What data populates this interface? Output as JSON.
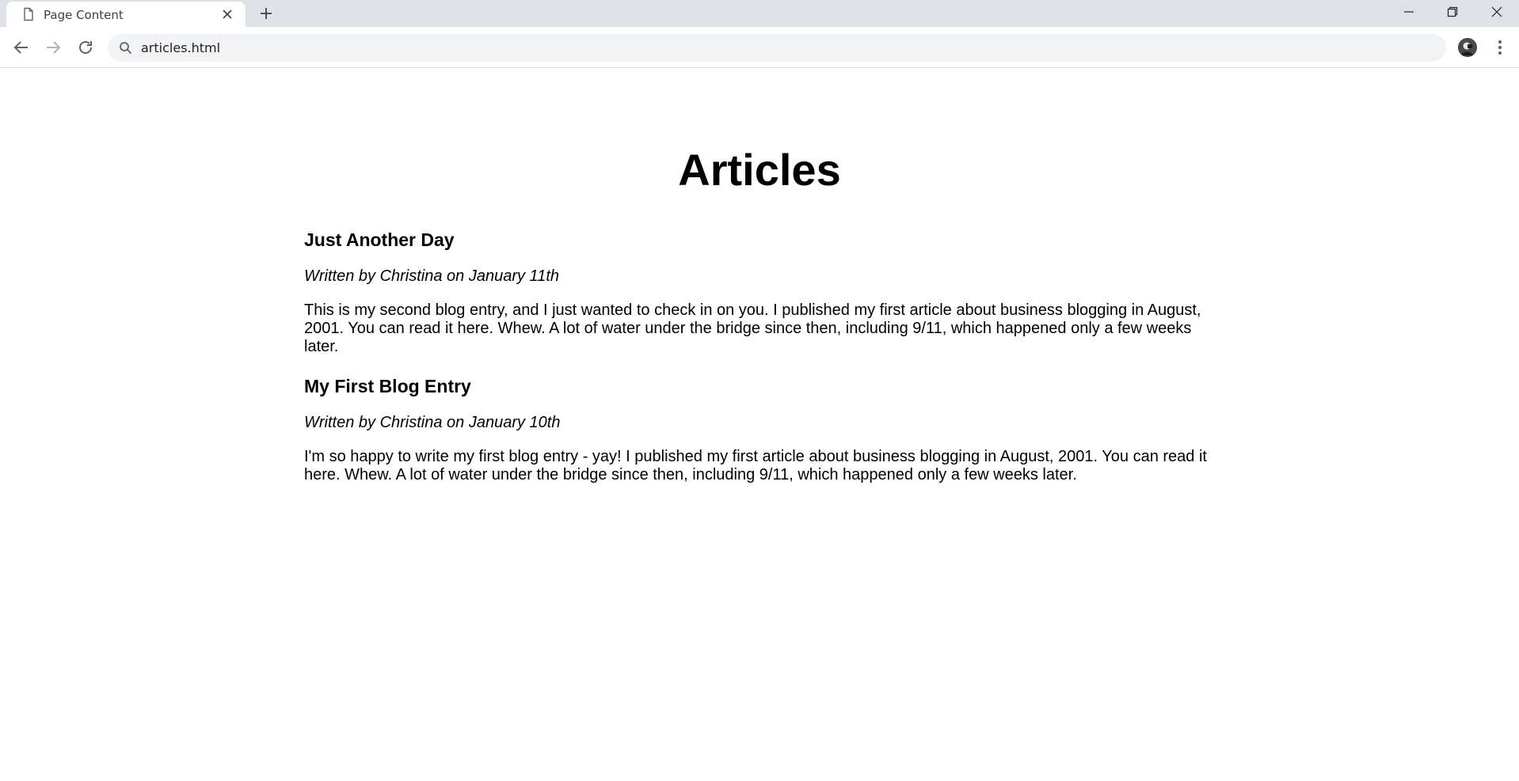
{
  "browser": {
    "tab": {
      "title": "Page Content"
    },
    "address": {
      "value": "articles.html"
    }
  },
  "icons": {
    "tab_favicon": "document-icon",
    "tab_close": "close-icon",
    "new_tab": "plus-icon",
    "back": "arrow-left-icon",
    "forward": "arrow-right-icon",
    "reload": "reload-icon",
    "search": "search-icon",
    "profile": "avatar",
    "menu": "kebab-menu-icon",
    "minimize": "minimize-icon",
    "maximize": "restore-icon",
    "close_window": "close-icon"
  },
  "page": {
    "title": "Articles",
    "articles": [
      {
        "title": "Just Another Day",
        "byline": "Written by Christina on January 11th",
        "body": "This is my second blog entry, and I just wanted to check in on you. I published my first article about business blogging in August, 2001. You can read it here. Whew. A lot of water under the bridge since then, including 9/11, which happened only a few weeks later."
      },
      {
        "title": "My First Blog Entry",
        "byline": "Written by Christina on January 10th",
        "body": "I'm so happy to write my first blog entry - yay! I published my first article about business blogging in August, 2001. You can read it here. Whew. A lot of water under the bridge since then, including 9/11, which happened only a few weeks later."
      }
    ]
  },
  "colors": {
    "tabstrip": "#dee1e6",
    "omnibox": "#f1f3f4",
    "icon": "#5f6368",
    "icon_disabled": "#b0b3b8"
  }
}
